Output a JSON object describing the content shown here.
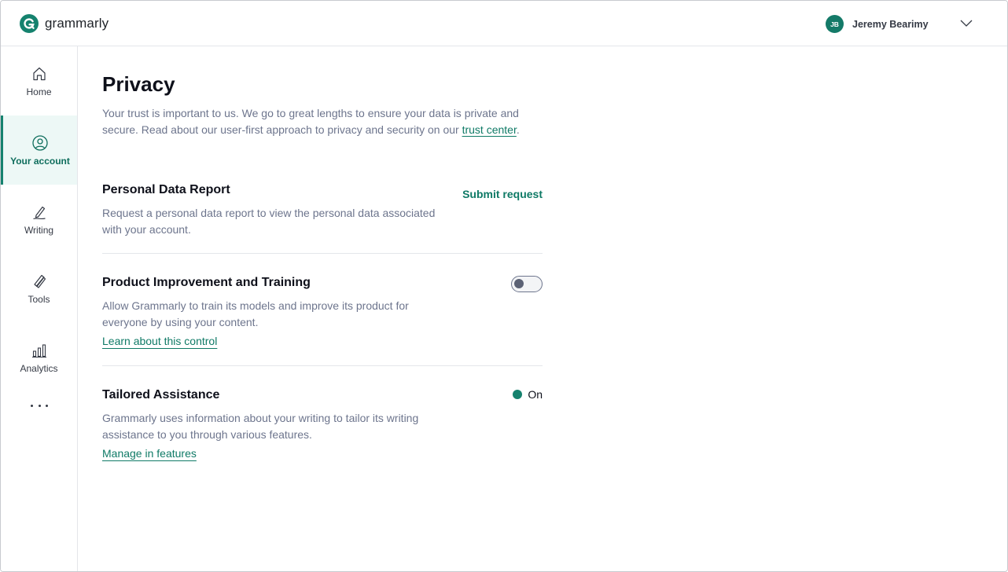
{
  "brand": {
    "name": "grammarly",
    "accent": "#15826e"
  },
  "header": {
    "user_initials": "JB",
    "user_name": "Jeremy Bearimy",
    "menu_icon": "chevron-down-icon"
  },
  "sidebar": {
    "items": [
      {
        "label": "Home",
        "icon": "home-icon"
      },
      {
        "label": "Your account",
        "icon": "user-circle-icon",
        "active": true
      },
      {
        "label": "Writing",
        "icon": "pen-icon"
      },
      {
        "label": "Tools",
        "icon": "tools-icon"
      },
      {
        "label": "Analytics",
        "icon": "bar-chart-icon"
      }
    ],
    "more_icon": "more-dots-icon"
  },
  "main": {
    "title": "Privacy",
    "intro_text": "Your trust is important to us. We go to great lengths to ensure your data is private and secure. Read about our user-first approach to privacy and security on our ",
    "intro_link": "trust center",
    "intro_end": ".",
    "sections": [
      {
        "title": "Personal Data Report",
        "description": "Request a personal data report to view the personal data associated with your account.",
        "action_label": "Submit request"
      },
      {
        "title": "Product Improvement and Training",
        "description": "Allow Grammarly to train its models and improve its product for everyone by using your content.",
        "link": "Learn about this control",
        "toggle_on": false
      },
      {
        "title": "Tailored Assistance",
        "description": "Grammarly uses information about your writing to tailor its writing assistance to you through various features.",
        "link": "Manage in features",
        "status": "On"
      }
    ]
  }
}
